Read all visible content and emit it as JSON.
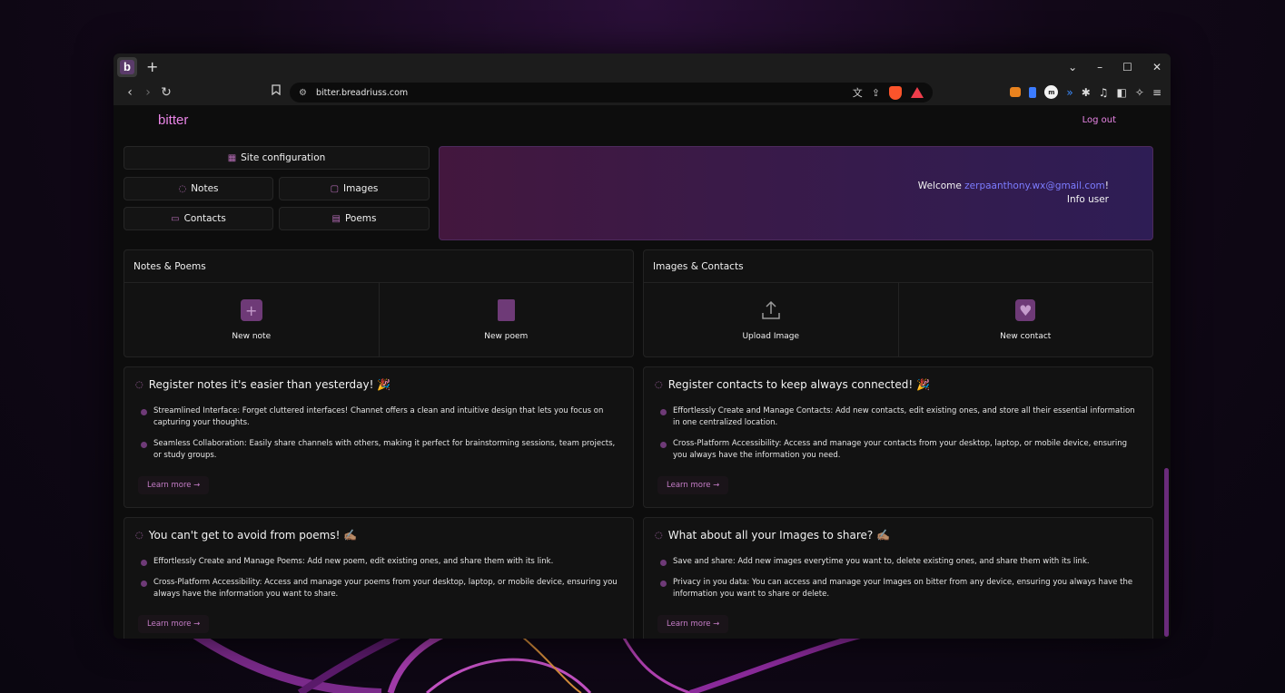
{
  "browser": {
    "tab_letter": "b",
    "new_tab": "+",
    "url": "bitter.breadriuss.com",
    "controls": {
      "dropdown": "⌄",
      "minimize": "–",
      "maximize": "☐",
      "close": "✕"
    }
  },
  "header": {
    "brand": "bitter",
    "logout": "Log out"
  },
  "nav": {
    "site_config": "Site configuration",
    "notes": "Notes",
    "images": "Images",
    "contacts": "Contacts",
    "poems": "Poems"
  },
  "welcome": {
    "prefix": "Welcome ",
    "email": "zerpaanthony.wx@gmail.com",
    "suffix": "!",
    "info": "Info user"
  },
  "panels": {
    "notes_poems": {
      "title": "Notes & Poems",
      "new_note": "New note",
      "new_poem": "New poem"
    },
    "images_contacts": {
      "title": "Images & Contacts",
      "upload_image": "Upload Image",
      "new_contact": "New contact"
    }
  },
  "features": {
    "notes": {
      "title": "Register notes it's easier than yesterday! 🎉",
      "b1": "Streamlined Interface: Forget cluttered interfaces! Channet offers a clean and intuitive design that lets you focus on capturing your thoughts.",
      "b2": "Seamless Collaboration: Easily share channels with others, making it perfect for brainstorming sessions, team projects, or study groups.",
      "learn": "Learn more →"
    },
    "contacts": {
      "title": "Register contacts to keep always connected! 🎉",
      "b1": "Effortlessly Create and Manage Contacts: Add new contacts, edit existing ones, and store all their essential information in one centralized location.",
      "b2": "Cross-Platform Accessibility: Access and manage your contacts from your desktop, laptop, or mobile device, ensuring you always have the information you need.",
      "learn": "Learn more →"
    },
    "poems": {
      "title": "You can't get to avoid from poems! ✍🏽",
      "b1": "Effortlessly Create and Manage Poems: Add new poem, edit existing ones, and share them with its link.",
      "b2": "Cross-Platform Accessibility: Access and manage your poems from your desktop, laptop, or mobile device, ensuring you always have the information you want to share.",
      "learn": "Learn more →"
    },
    "images": {
      "title": "What about all your Images to share? ✍🏽",
      "b1": "Save and share: Add new images everytime you want to, delete existing ones, and share them with its link.",
      "b2": "Privacy in you data: You can access and manage your Images on bitter from any device, ensuring you always have the information you want to share or delete.",
      "learn": "Learn more →"
    }
  },
  "colors": {
    "accent": "#e985e6",
    "icon": "#6e3a77",
    "email": "#7c7cff"
  }
}
